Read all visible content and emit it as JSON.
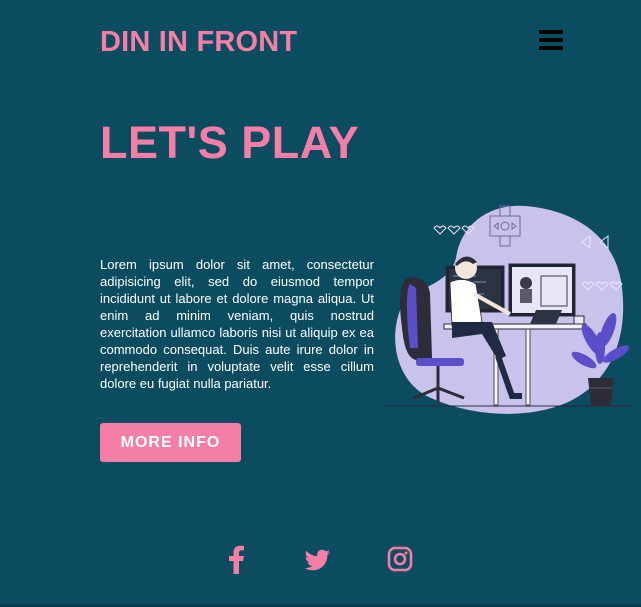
{
  "header": {
    "brand": "DIN IN FRONT",
    "menu_icon": "hamburger-menu-icon"
  },
  "hero": {
    "title": "LET'S PLAY",
    "description": "Lorem ipsum dolor sit amet, consectetur adipisicing elit, sed do eiusmod tempor incididunt ut labore et dolore magna aliqua. Ut enim ad minim veniam, quis nostrud exercitation ullamco laboris nisi ut aliquip ex ea commodo consequat. Duis aute irure dolor in reprehenderit in voluptate velit esse cillum dolore eu fugiat nulla pariatur.",
    "button_label": "MORE INFO",
    "illustration": "gamer-at-desk-illustration"
  },
  "social": {
    "icons": [
      "facebook-icon",
      "twitter-icon",
      "instagram-icon"
    ]
  },
  "colors": {
    "background": "#0b4c61",
    "accent": "#f57ea6",
    "text": "#ffffff",
    "illustration_blob": "#c9c3ec",
    "illustration_purple": "#5a4fc8"
  }
}
